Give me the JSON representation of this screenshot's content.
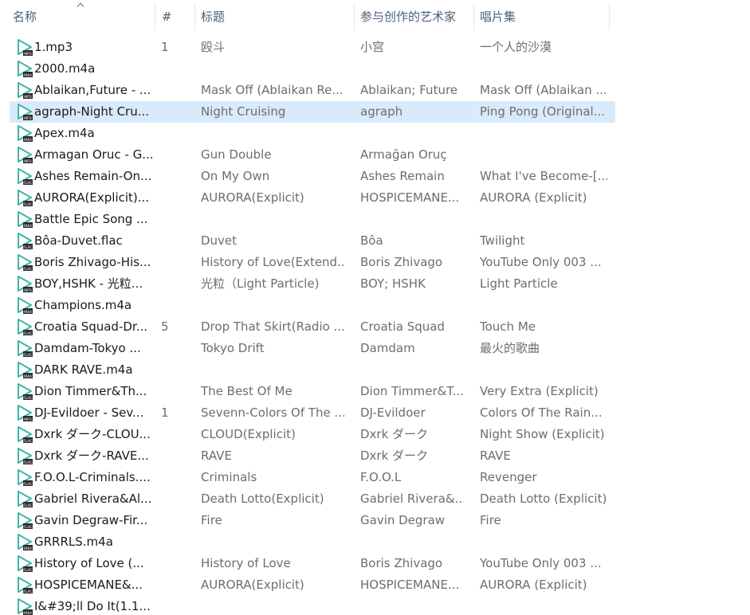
{
  "columns": {
    "name": "名称",
    "number": "#",
    "title": "标题",
    "artists": "参与创作的艺术家",
    "album": "唱片集"
  },
  "sort": {
    "column": "name",
    "direction": "ascending",
    "icon": "sort-ascending-icon"
  },
  "colors": {
    "header_text": "#4c607a",
    "selected_row": "#d9ebfb",
    "icon_accent": "#3fb5a5",
    "secondary_text": "#6d6d6d"
  },
  "files": [
    {
      "name": "1.mp3",
      "num": "1",
      "title": "殴斗",
      "artist": "小宫",
      "album": "一个人的沙漠",
      "badge": "MP3"
    },
    {
      "name": "2000.m4a",
      "num": "",
      "title": "",
      "artist": "",
      "album": "",
      "badge": "M4A"
    },
    {
      "name": "Ablaikan,Future - ...",
      "num": "",
      "title": "Mask Off (Ablaikan Re...",
      "artist": "Ablaikan; Future",
      "album": "Mask Off (Ablaikan ...",
      "badge": "MP3"
    },
    {
      "name": "agraph-Night Cru...",
      "num": "",
      "title": "Night Cruising",
      "artist": "agraph",
      "album": "Ping Pong (Original...",
      "badge": "MP3",
      "selected": true
    },
    {
      "name": "Apex.m4a",
      "num": "",
      "title": "",
      "artist": "",
      "album": "",
      "badge": "M4A"
    },
    {
      "name": "Armagan Oruc - G...",
      "num": "",
      "title": "Gun Double",
      "artist": "Armağan Oruç",
      "album": "",
      "badge": "MP3"
    },
    {
      "name": "Ashes Remain-On...",
      "num": "",
      "title": "On My Own",
      "artist": "Ashes Remain",
      "album": "What I've Become-[...",
      "badge": "FLAC"
    },
    {
      "name": "AURORA(Explicit)...",
      "num": "",
      "title": "AURORA(Explicit)",
      "artist": "HOSPICEMANE...",
      "album": "AURORA (Explicit)",
      "badge": "FLAC"
    },
    {
      "name": "Battle Epic Song ...",
      "num": "",
      "title": "",
      "artist": "",
      "album": "",
      "badge": "M4A"
    },
    {
      "name": "Bôa-Duvet.flac",
      "num": "",
      "title": "Duvet",
      "artist": "Bôa",
      "album": "Twilight",
      "badge": "FLAC"
    },
    {
      "name": "Boris Zhivago-His...",
      "num": "",
      "title": "History of Love(Extend...",
      "artist": "Boris Zhivago",
      "album": "YouTube Only 003 ...",
      "badge": "FLAC"
    },
    {
      "name": "BOY,HSHK - 光粒...",
      "num": "",
      "title": "光粒（Light Particle)",
      "artist": "BOY; HSHK",
      "album": "Light Particle",
      "badge": "MP3"
    },
    {
      "name": "Champions.m4a",
      "num": "",
      "title": "",
      "artist": "",
      "album": "",
      "badge": "M4A"
    },
    {
      "name": "Croatia Squad-Dr...",
      "num": "5",
      "title": "Drop That Skirt(Radio ...",
      "artist": "Croatia Squad",
      "album": "Touch Me",
      "badge": "FLAC"
    },
    {
      "name": "Damdam-Tokyo ...",
      "num": "",
      "title": "Tokyo Drift",
      "artist": "Damdam",
      "album": "最火的歌曲",
      "badge": "FLAC"
    },
    {
      "name": "DARK RAVE.m4a",
      "num": "",
      "title": "",
      "artist": "",
      "album": "",
      "badge": "M4A"
    },
    {
      "name": "Dion Timmer&Th...",
      "num": "",
      "title": "The Best Of Me",
      "artist": "Dion Timmer&T...",
      "album": "Very Extra (Explicit)",
      "badge": "FLAC"
    },
    {
      "name": "DJ-Evildoer - Sev...",
      "num": "1",
      "title": "Sevenn-Colors Of The ...",
      "artist": "DJ-Evildoer",
      "album": "Colors Of The Rain...",
      "badge": "MP3"
    },
    {
      "name": "Dxrk ダーク-CLOU...",
      "num": "",
      "title": "CLOUD(Explicit)",
      "artist": "Dxrk ダーク",
      "album": "Night Show (Explicit)",
      "badge": "FLAC"
    },
    {
      "name": "Dxrk ダーク-RAVE...",
      "num": "",
      "title": "RAVE",
      "artist": "Dxrk ダーク",
      "album": "RAVE",
      "badge": "FLAC"
    },
    {
      "name": "F.O.O.L-Criminals....",
      "num": "",
      "title": "Criminals",
      "artist": "F.O.O.L",
      "album": "Revenger",
      "badge": "FLAC"
    },
    {
      "name": "Gabriel Rivera&Al...",
      "num": "",
      "title": "Death Lotto(Explicit)",
      "artist": "Gabriel Rivera&...",
      "album": "Death Lotto (Explicit)",
      "badge": "FLAC"
    },
    {
      "name": "Gavin Degraw-Fir...",
      "num": "",
      "title": "Fire",
      "artist": "Gavin Degraw",
      "album": "Fire",
      "badge": "FLAC"
    },
    {
      "name": "GRRRLS.m4a",
      "num": "",
      "title": "",
      "artist": "",
      "album": "",
      "badge": "M4A"
    },
    {
      "name": "History of Love (...",
      "num": "",
      "title": "History of Love",
      "artist": "Boris Zhivago",
      "album": "YouTube Only 003 ...",
      "badge": "FLAC"
    },
    {
      "name": "HOSPICEMANE&...",
      "num": "",
      "title": "AURORA(Explicit)",
      "artist": "HOSPICEMANE...",
      "album": "AURORA (Explicit)",
      "badge": "FLAC"
    },
    {
      "name": "I&#39;ll Do It(1.1...",
      "num": "",
      "title": "",
      "artist": "",
      "album": "",
      "badge": "M4A"
    }
  ]
}
